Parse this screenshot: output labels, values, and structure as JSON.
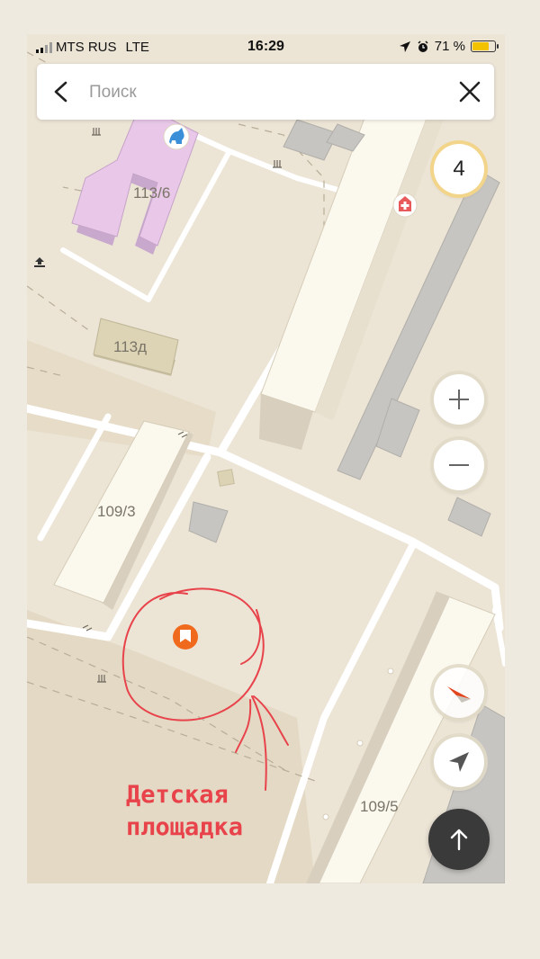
{
  "status_bar": {
    "carrier": "MTS RUS",
    "network": "LTE",
    "time": "16:29",
    "battery_percent": "71 %",
    "battery_level": 0.71
  },
  "search": {
    "placeholder": "Поиск",
    "back_icon": "chevron-left-icon",
    "close_icon": "close-icon"
  },
  "map": {
    "building_labels": [
      "113/6",
      "113д",
      "109/3",
      "109/5"
    ],
    "poi_icons": [
      "kindergarten-icon",
      "hospital-icon",
      "playground-pin-icon",
      "entrance-icon"
    ]
  },
  "controls": {
    "traffic_level": "4",
    "zoom_in": "+",
    "zoom_out": "−",
    "compass_icon": "compass-icon",
    "locate_icon": "location-arrow-icon",
    "route_icon": "arrow-up-icon"
  },
  "annotation": {
    "text": "Детская\nплощадка",
    "color": "#e8434b"
  },
  "colors": {
    "ground": "#ece4d5",
    "road": "#ffffff",
    "building": "#fbf8ee",
    "kindergarten": "#e8c7e8",
    "pin": "#f06a1d"
  }
}
